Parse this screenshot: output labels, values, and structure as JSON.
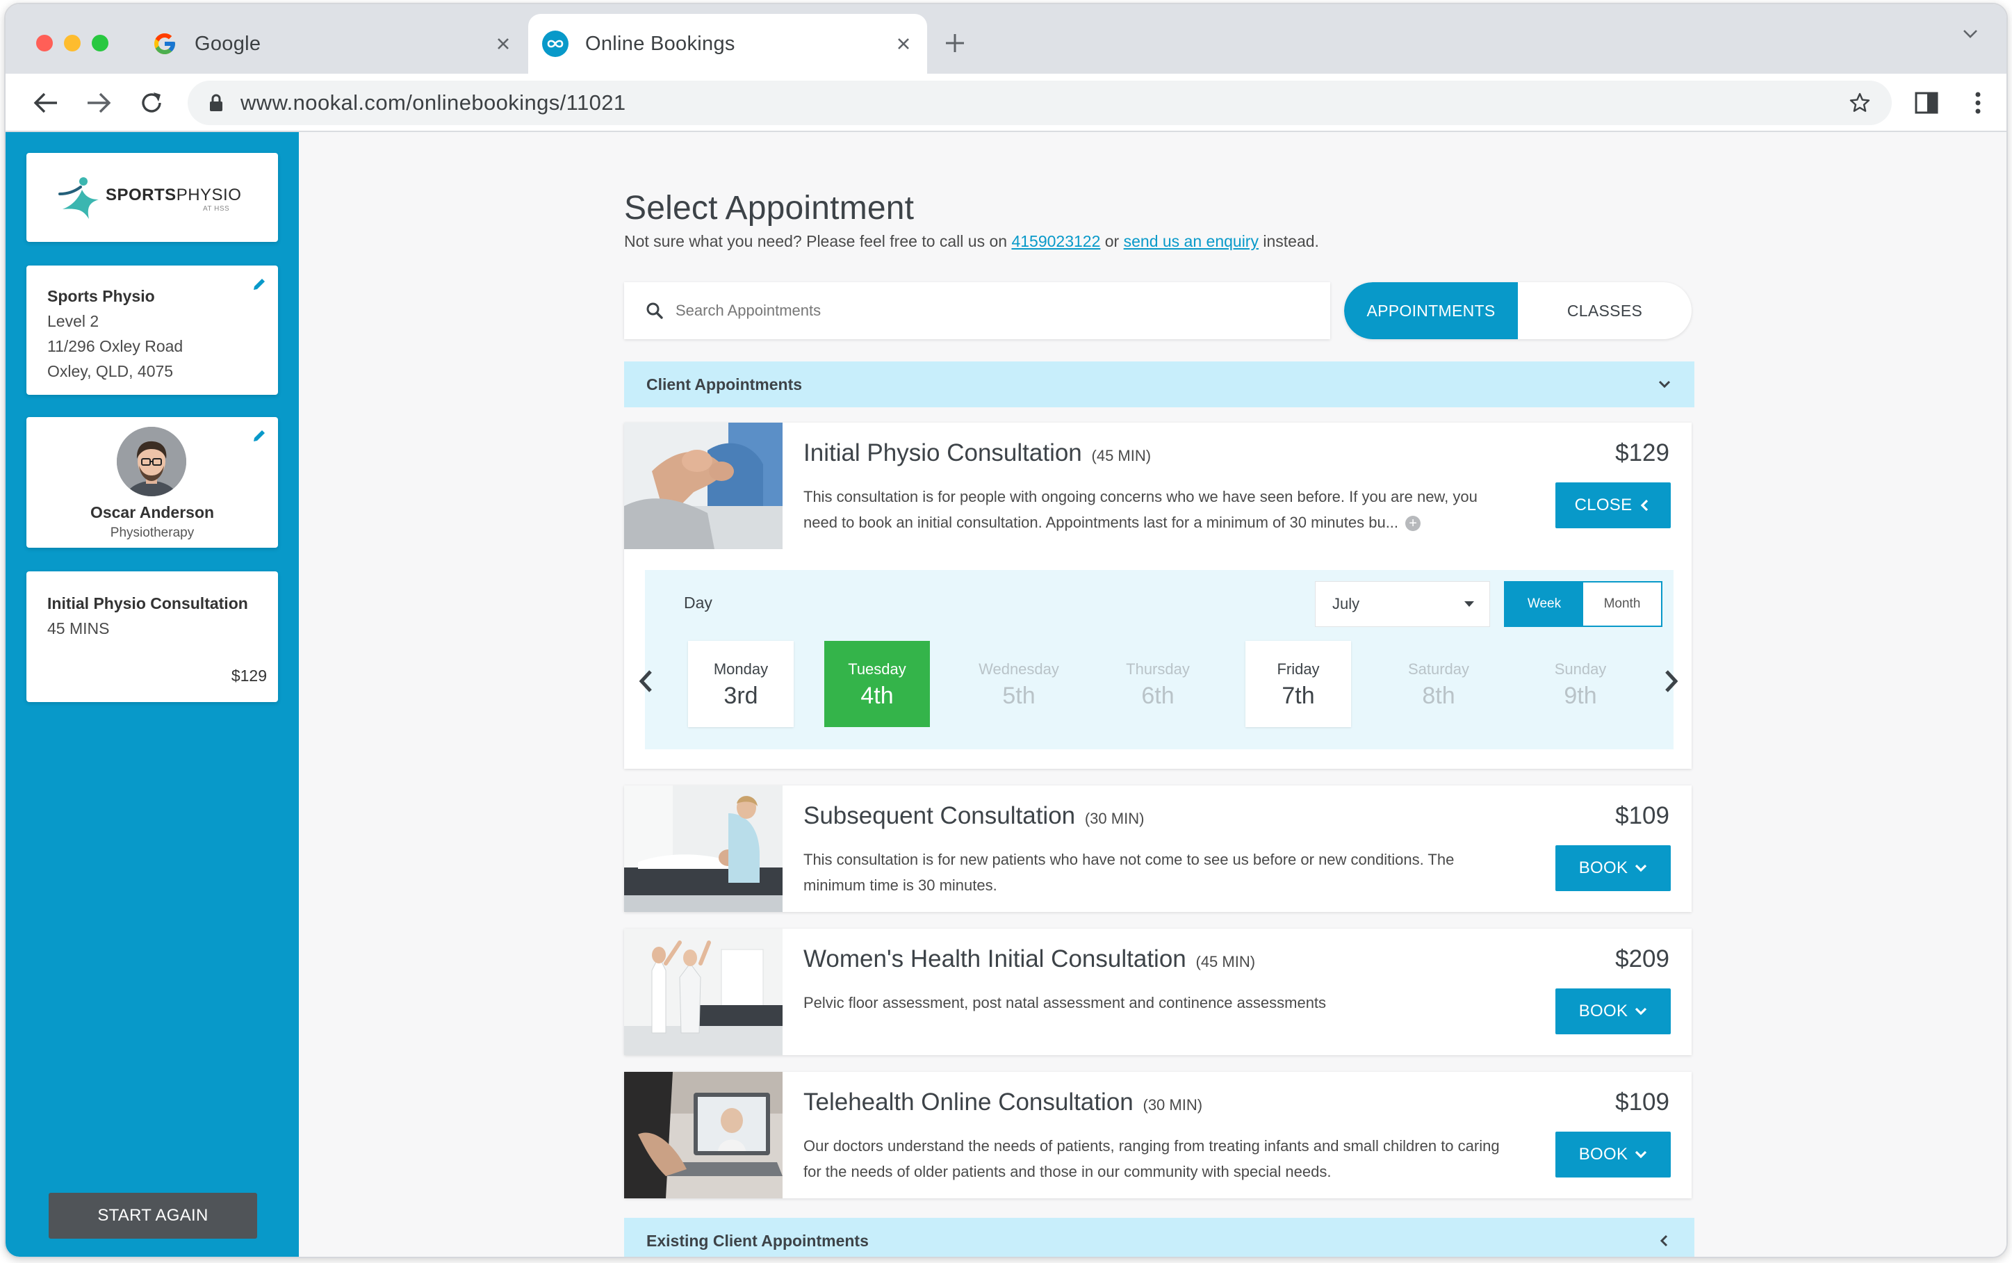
{
  "browser": {
    "tabs": [
      {
        "title": "Google",
        "icon": "google-g-icon"
      },
      {
        "title": "Online Bookings",
        "icon": "nookal-infinity-icon"
      }
    ],
    "url": "www.nookal.com/onlinebookings/11021"
  },
  "sidebar": {
    "logo": {
      "word_bold": "SPORTS",
      "word_light": "PHYSIO",
      "tagline": "AT HSS"
    },
    "location": {
      "name": "Sports Physio",
      "line1": "Level 2",
      "line2": "11/296 Oxley Road",
      "line3": "Oxley, QLD, 4075"
    },
    "practitioner": {
      "name": "Oscar Anderson",
      "role": "Physiotherapy"
    },
    "service": {
      "name": "Initial Physio Consultation",
      "duration": "45 MINS",
      "price": "$129"
    },
    "start_again": "START AGAIN"
  },
  "main": {
    "title": "Select Appointment",
    "intro": {
      "before": "Not sure what you need? Please feel free to call us on ",
      "phone": "4159023122",
      "middle": " or ",
      "enquiry_link": "send us an enquiry",
      "after": " instead."
    },
    "search": {
      "placeholder": "Search Appointments"
    },
    "toggle": {
      "appointments": "APPOINTMENTS",
      "classes": "CLASSES",
      "active": "appointments"
    },
    "client_section": "Client Appointments",
    "existing_section": "Existing Client Appointments",
    "appointments": [
      {
        "title": "Initial Physio Consultation",
        "duration": "(45 MIN)",
        "price": "$129",
        "description": "This consultation is for people with ongoing concerns who we have seen before. If you are new, you need to book an initial consultation. Appointments last for a minimum of 30 minutes bu...",
        "button": "CLOSE",
        "expanded": true
      },
      {
        "title": "Subsequent Consultation",
        "duration": "(30 MIN)",
        "price": "$109",
        "description": "This consultation is for new patients who have not come to see us before or new conditions. The minimum time is 30 minutes.",
        "button": "BOOK"
      },
      {
        "title": "Women's Health Initial Consultation",
        "duration": "(45 MIN)",
        "price": "$209",
        "description": "Pelvic floor assessment, post natal assessment and continence assessments",
        "button": "BOOK"
      },
      {
        "title": "Telehealth Online Consultation",
        "duration": "(30 MIN)",
        "price": "$109",
        "description": "Our doctors understand the needs of patients, ranging from treating infants and small children to caring for the needs of older patients and those in our community with special needs.",
        "button": "BOOK"
      }
    ],
    "calendar": {
      "label": "Day",
      "month": "July",
      "views": {
        "week": "Week",
        "month": "Month",
        "active": "week"
      },
      "days": [
        {
          "name": "Monday",
          "num": "3rd",
          "state": "available"
        },
        {
          "name": "Tuesday",
          "num": "4th",
          "state": "selected"
        },
        {
          "name": "Wednesday",
          "num": "5th",
          "state": "unavailable"
        },
        {
          "name": "Thursday",
          "num": "6th",
          "state": "unavailable"
        },
        {
          "name": "Friday",
          "num": "7th",
          "state": "available"
        },
        {
          "name": "Saturday",
          "num": "8th",
          "state": "unavailable"
        },
        {
          "name": "Sunday",
          "num": "9th",
          "state": "unavailable"
        }
      ]
    }
  },
  "colors": {
    "brand_blue": "#0899c9",
    "section_bg": "#c8eefb",
    "selected_green": "#34b44a",
    "start_again_bg": "#505458"
  }
}
